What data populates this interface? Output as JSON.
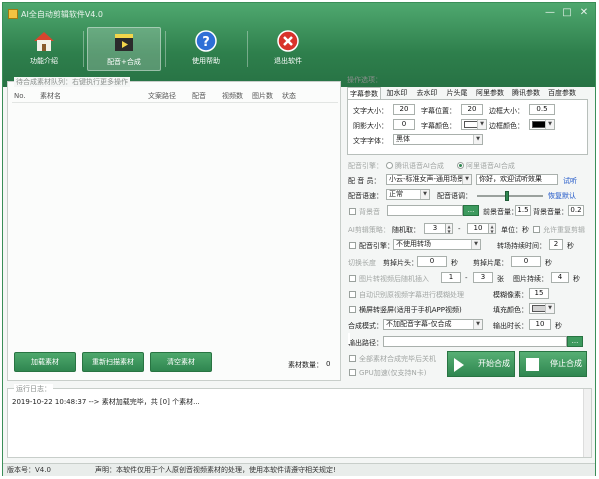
{
  "app": {
    "title": "AI全自动剪辑软件V4.0",
    "accent": "#2f8650"
  },
  "window_controls": {
    "min": "—",
    "max": "□",
    "close": "✕"
  },
  "nav": [
    {
      "label": "功能介绍",
      "icon": "home-icon"
    },
    {
      "label": "配音+合成",
      "icon": "film-clapper-icon"
    },
    {
      "label": "使用帮助",
      "icon": "help-icon"
    },
    {
      "label": "退出软件",
      "icon": "exit-icon"
    }
  ],
  "queue": {
    "title": "待合成素材队列：右键执行更多操作",
    "columns": [
      "No.",
      "素材名",
      "文案路径",
      "配音",
      "视频数",
      "图片数",
      "状态"
    ],
    "buttons": {
      "load": "加载素材",
      "rescan": "重新扫描素材",
      "clear": "清空素材"
    },
    "count_label": "素材数量：",
    "count_value": "0"
  },
  "options": {
    "title": "操作选项：",
    "tabs": [
      "字幕参数",
      "加水印",
      "去水印",
      "片头尾",
      "阿里参数",
      "腾讯参数",
      "百度参数"
    ],
    "subtitle": {
      "font_size_label": "文字大小：",
      "font_size": "20",
      "position_label": "字幕位置：",
      "position": "20",
      "border_size_label": "边框大小：",
      "border_size": "0.5",
      "shadow_label": "阴影大小：",
      "shadow": "0",
      "font_color_label": "字幕颜色：",
      "font_color": "#ffffff",
      "border_color_label": "边框颜色：",
      "border_color": "#000000",
      "font_family_label": "文字字体：",
      "font_family": "黑体"
    },
    "voice": {
      "engine_label": "配音引擎：",
      "engine_tencent": "腾讯语音AI合成",
      "engine_ali": "阿里语音AI合成",
      "speaker_label": "配  音  员：",
      "speaker": "小云-标准女声-通用场景",
      "sample_text": "你好，欢迎试听效果",
      "preview": "试听",
      "speed_label": "配音语速：",
      "speed": "正常",
      "intonation_label": "配音语调：",
      "restore": "恢复默认",
      "bgm_label": "背景音",
      "bgm_path": "",
      "browse": "...",
      "front_mute_label": "前景音量：",
      "front_mute": "1.5",
      "bgm_volume_label": "背景音量：",
      "bgm_volume": "0.2"
    },
    "cut": {
      "ai_label": "AI剪辑策略：",
      "random_label": "随机取：",
      "random_min": "3",
      "random_sep": "-",
      "random_max": "10",
      "unit_label": "单位：",
      "unit": "秒",
      "repeat_label": "允许重复剪辑",
      "engine_label": "配音引擎：",
      "transition": "不使用转场",
      "transition_time_label": "转场持续时间：",
      "transition_time": "2",
      "transition_unit": "秒",
      "trim_label": "剪掉片头：",
      "trim_head": "0",
      "trim_head_unit": "秒",
      "trim_tail_label": "剪掉片尾：",
      "trim_tail": "0",
      "trim_tail_unit": "秒",
      "image_insert_label": "图片转视频后随机插入",
      "image_min": "1",
      "image_sep": "-",
      "image_max": "3",
      "image_unit": "张",
      "image_duration_label": "图片持续：",
      "image_duration": "4",
      "image_duration_unit": "秒",
      "blur_label": "自动识别原视频字幕进行模糊处理",
      "blur_px_label": "模糊像素：",
      "blur_px": "15",
      "vertical_label": "横屏转竖屏(适用于手机APP视频)",
      "fill_color_label": "填充颜色：",
      "fill_color": "#d2d2d2",
      "mode_label": "合成模式：",
      "mode": "不加配音字幕-仅合成",
      "duration_label": "输出时长：",
      "duration": "10",
      "duration_unit": "秒",
      "output_label": "输出路径：",
      "output_path": "",
      "output_browse": "...",
      "shutdown_label": "全部素材合成完毕后关机",
      "gpu_label": "GPU加速(仅支持N卡)",
      "start": "开始合成",
      "stop": "停止合成"
    }
  },
  "log": {
    "title": "运行日志：",
    "line": "2019-10-22 10:48:37 --> 素材加载完毕，共 [0] 个素材..."
  },
  "statusbar": {
    "version": "版本号：V4.0",
    "notice": "声明：本软件仅用于个人原创音视频素材的处理，使用本软件请遵守相关规定!"
  }
}
